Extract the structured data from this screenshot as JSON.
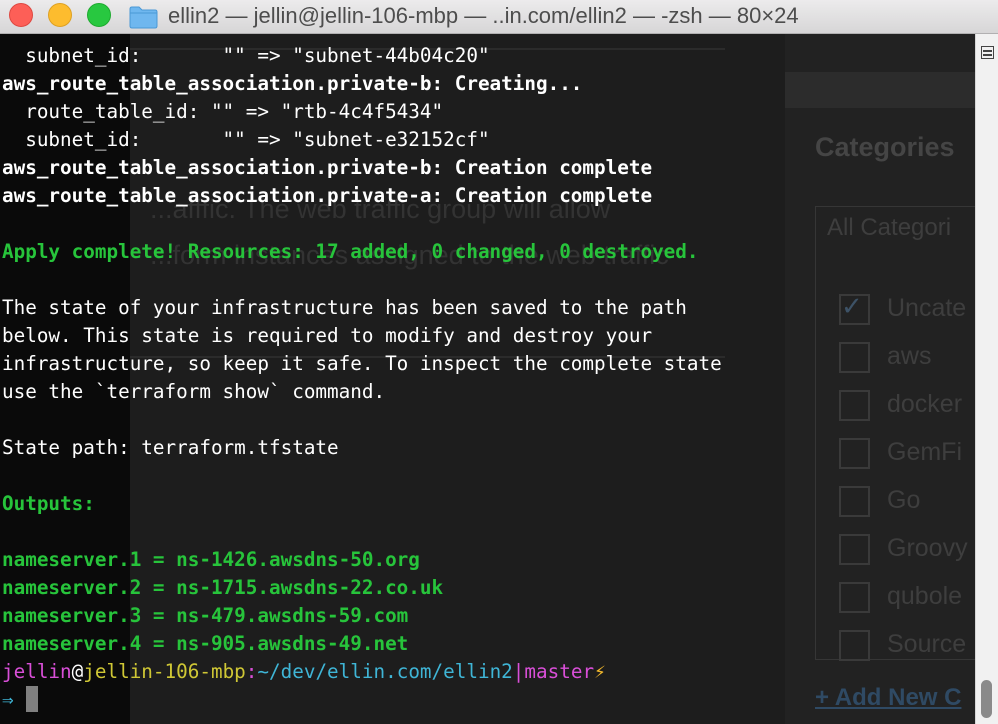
{
  "window": {
    "title": "ellin2 — jellin@jellin-106-mbp — ..in.com/ellin2 — -zsh — 80×24",
    "icon": "folder-icon"
  },
  "background_page": {
    "sidebar_heading": "Categories",
    "categories_select": "All Categori",
    "categories": [
      {
        "label": "Uncate",
        "checked": true
      },
      {
        "label": "aws",
        "checked": false
      },
      {
        "label": "docker",
        "checked": false
      },
      {
        "label": "GemFi",
        "checked": false
      },
      {
        "label": "Go",
        "checked": false
      },
      {
        "label": "Groovy",
        "checked": false
      },
      {
        "label": "qubole",
        "checked": false
      },
      {
        "label": "Source",
        "checked": false
      }
    ],
    "add_new_link": "+ Add New C",
    "body_fragment_1": "...afffic. The web traffic group will allow",
    "body_fragment_2": "...form instances assigned to the web traffic"
  },
  "terminal": {
    "lines": [
      {
        "text": "  subnet_id:       \"\" => \"subnet-44b04c20\"",
        "style": "normal"
      },
      {
        "text": "aws_route_table_association.private-b: Creating...",
        "style": "bold"
      },
      {
        "text": "  route_table_id: \"\" => \"rtb-4c4f5434\"",
        "style": "normal"
      },
      {
        "text": "  subnet_id:       \"\" => \"subnet-e32152cf\"",
        "style": "normal"
      },
      {
        "text": "aws_route_table_association.private-b: Creation complete",
        "style": "bold"
      },
      {
        "text": "aws_route_table_association.private-a: Creation complete",
        "style": "bold"
      },
      {
        "text": "",
        "style": "normal"
      },
      {
        "text": "Apply complete! Resources: 17 added, 0 changed, 0 destroyed.",
        "style": "bold-green"
      },
      {
        "text": "",
        "style": "normal"
      },
      {
        "text": "The state of your infrastructure has been saved to the path",
        "style": "normal"
      },
      {
        "text": "below. This state is required to modify and destroy your",
        "style": "normal"
      },
      {
        "text": "infrastructure, so keep it safe. To inspect the complete state",
        "style": "normal"
      },
      {
        "text": "use the `terraform show` command.",
        "style": "normal"
      },
      {
        "text": "",
        "style": "normal"
      },
      {
        "text": "State path: terraform.tfstate",
        "style": "normal"
      },
      {
        "text": "",
        "style": "normal"
      },
      {
        "text": "Outputs:",
        "style": "bold-green"
      },
      {
        "text": "",
        "style": "normal"
      },
      {
        "text": "nameserver.1 = ns-1426.awsdns-50.org",
        "style": "bold-green"
      },
      {
        "text": "nameserver.2 = ns-1715.awsdns-22.co.uk",
        "style": "bold-green"
      },
      {
        "text": "nameserver.3 = ns-479.awsdns-59.com",
        "style": "bold-green"
      },
      {
        "text": "nameserver.4 = ns-905.awsdns-49.net",
        "style": "bold-green"
      }
    ],
    "prompt": {
      "user": "jellin",
      "at": "@",
      "host": "jellin-106-mbp",
      "colon": ":",
      "path": "~/dev/ellin.com/ellin2",
      "separator": "|",
      "branch": "master",
      "status_icon": "⚡",
      "arrow": "⇒"
    }
  },
  "colors": {
    "terminal_bg": "#151515",
    "text": "#ffffff",
    "green": "#27c43b",
    "magenta": "#d94fd8",
    "yellow": "#cfc735",
    "cyan": "#3fb5d6",
    "bolt": "#f2b82c"
  }
}
